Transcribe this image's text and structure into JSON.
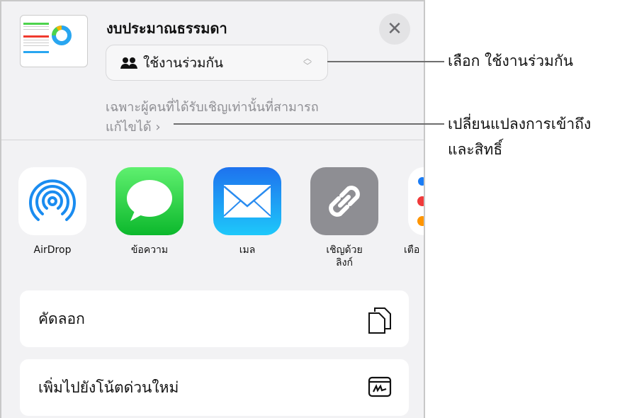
{
  "header": {
    "title": "งบประมาณธรรมดา",
    "close_icon": "close-icon"
  },
  "share_mode": {
    "label": "ใช้งานร่วมกัน",
    "icon": "people-icon"
  },
  "access_description": {
    "line1": "เฉพาะผู้คนที่ได้รับเชิญเท่านั้นที่สามารถ",
    "line2": "แก้ไขได้"
  },
  "apps": [
    {
      "label": "AirDrop",
      "icon": "airdrop-icon"
    },
    {
      "label": "ข้อความ",
      "icon": "messages-icon",
      "color": "#28c840"
    },
    {
      "label": "เมล",
      "icon": "mail-icon",
      "color": "#1e90f5"
    },
    {
      "label_line1": "เชิญด้วย",
      "label_line2": "ลิงก์",
      "icon": "link-icon",
      "color": "#8e8e93"
    },
    {
      "label": "เตือ",
      "icon": "reminders-icon"
    }
  ],
  "actions": [
    {
      "label": "คัดลอก",
      "icon": "copy-icon"
    },
    {
      "label": "เพิ่มไปยังโน้ตด่วนใหม่",
      "icon": "quick-note-icon"
    }
  ],
  "callouts": {
    "select_share": "เลือก ใช้งานร่วมกัน",
    "change_access_line1": "เปลี่ยนแปลงการเข้าถึง",
    "change_access_line2": "และสิทธิ์"
  }
}
